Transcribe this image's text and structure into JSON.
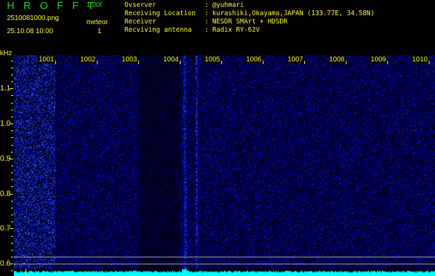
{
  "header": {
    "app_title": "HROFFT",
    "version": "1.00f",
    "filename": "2510081000.png",
    "datetime": "25.10.08 10:00",
    "meteor_label": "meteor",
    "meteor_count": "1"
  },
  "info": [
    {
      "label": "Ovserver",
      "value": "@yuhmari"
    },
    {
      "label": "Receiving Location",
      "value": "kurashiki,Okayama,JAPAN (133.77E, 34.58N)"
    },
    {
      "label": "Receiver",
      "value": "NESDR SMArt + HDSDR"
    },
    {
      "label": "Recviving antenna",
      "value": "Radix RY-62V"
    }
  ],
  "chart_data": {
    "type": "heatmap",
    "title": "HROFFT spectrogram",
    "ylabel": "kHz",
    "x_ticks": [
      "1001",
      "1002",
      "1003",
      "1004",
      "1005",
      "1006",
      "1007",
      "1008",
      "1009",
      "1010"
    ],
    "y_ticks": [
      "1.1",
      "1.0",
      "0.9",
      "0.8",
      "0.7",
      "0.6"
    ],
    "ylim": [
      0.565,
      1.195
    ],
    "meteor_echoes": [
      {
        "time_min": 1004.1,
        "freq_khz_range": [
          0.58,
          1.19
        ]
      }
    ],
    "reference_lines_khz": [
      0.62,
      0.6,
      0.58
    ],
    "colors": {
      "background": "#000033",
      "signal": "#1a2bff",
      "strong": "#33ffcc",
      "spectrum": "#00ffff",
      "grid": "#b0b0b0"
    }
  }
}
